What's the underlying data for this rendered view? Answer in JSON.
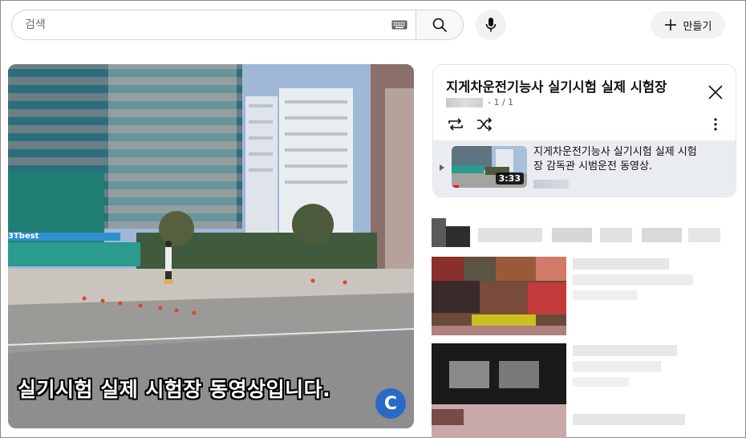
{
  "search": {
    "placeholder": "검색",
    "keyboard_icon": "keyboard-icon",
    "search_icon": "search-icon",
    "mic_icon": "mic-icon"
  },
  "create_button": {
    "label": "만들기",
    "icon": "plus-icon"
  },
  "video": {
    "caption": "실기시험 실제 시험장 동영상입니다.",
    "sign_text": "3Tbest",
    "channel_logo_letter": "C"
  },
  "playlist": {
    "title": "지게차운전기능사 실기시험 실제 시험장",
    "position": "- 1 / 1",
    "icons": [
      "loop-icon",
      "shuffle-icon",
      "more-vert-icon",
      "close-icon"
    ],
    "items": [
      {
        "title": "지게차운전기능사 실기시험 실제 시험장 감독관 시범운전 동영상.",
        "duration": "3:33",
        "watched_fraction": 0.1
      }
    ]
  },
  "colors": {
    "accent_red": "#ff0000",
    "selected_item_bg": "#e9ecf1",
    "button_bg": "#f2f2f2",
    "channel_logo": "#2a69c8"
  }
}
